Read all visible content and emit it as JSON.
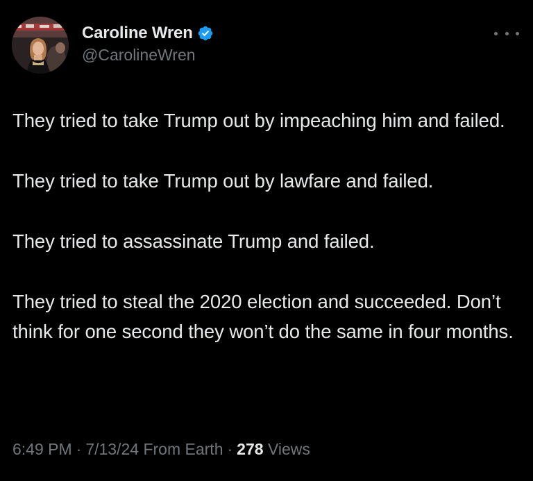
{
  "author": {
    "display_name": "Caroline Wren",
    "handle": "@CarolineWren",
    "verified": true
  },
  "tweet": {
    "paragraphs": [
      "They tried to take Trump out by impeaching him and failed.",
      "They tried to take Trump out by lawfare and failed.",
      "They tried to assassinate Trump and failed.",
      "They tried to steal the 2020 election and succeeded. Don’t think for one second they won’t do the same in four months."
    ],
    "time": "6:49 PM",
    "separator": "·",
    "date": "7/13/24",
    "source": "From Earth",
    "views_count": "278",
    "views_label": "Views"
  },
  "icons": {
    "verified": "verified-badge-icon",
    "more": "more-options-icon"
  },
  "colors": {
    "background": "#000000",
    "primary_text": "#e7e9ea",
    "secondary_text": "#71767b",
    "verified_blue": "#1d9bf0"
  }
}
